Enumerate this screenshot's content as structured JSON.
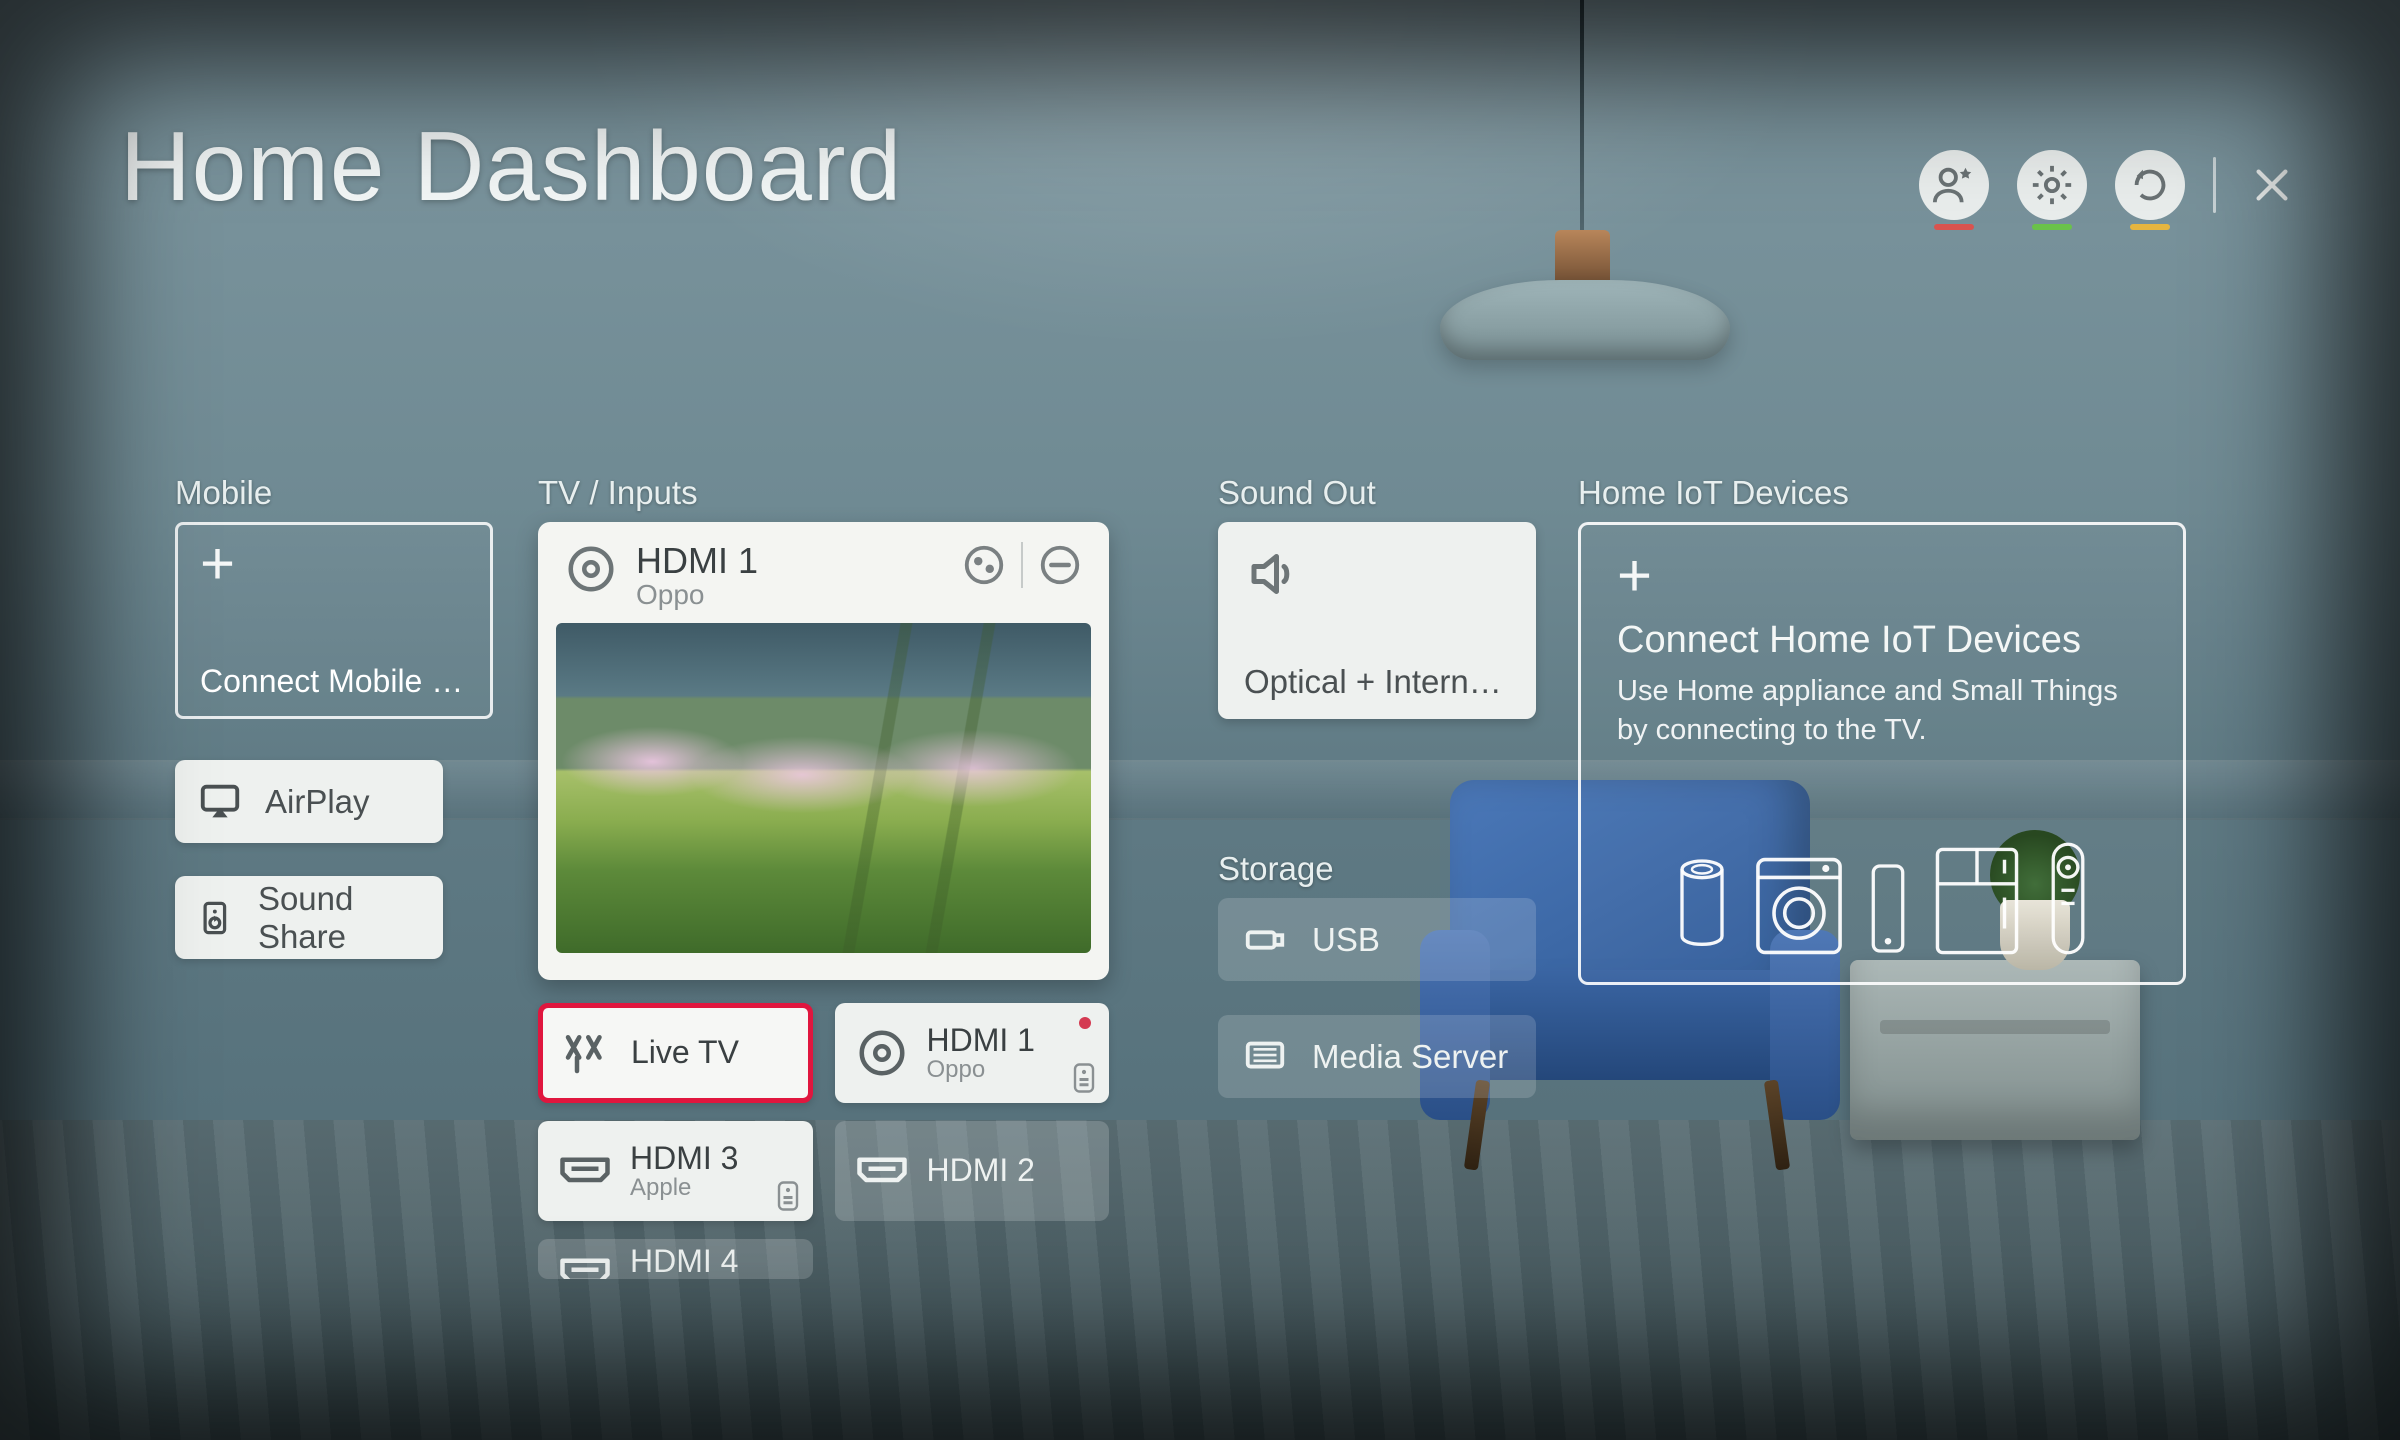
{
  "title": "Home Dashboard",
  "sections": {
    "mobile": "Mobile",
    "inputs": "TV / Inputs",
    "sound": "Sound Out",
    "storage": "Storage",
    "iot": "Home IoT Devices"
  },
  "mobile": {
    "connect_label": "Connect Mobile …",
    "airplay": "AirPlay",
    "sound_share": "Sound Share"
  },
  "inputs": {
    "hero": {
      "title": "HDMI 1",
      "subtitle": "Oppo"
    },
    "tiles": [
      {
        "title": "Live TV",
        "subtitle": "",
        "style": "focused",
        "icon": "antenna",
        "active": false,
        "remote": false
      },
      {
        "title": "HDMI 1",
        "subtitle": "Oppo",
        "style": "solid",
        "icon": "disc",
        "active": true,
        "remote": true
      },
      {
        "title": "HDMI 3",
        "subtitle": "Apple",
        "style": "solid",
        "icon": "hdmi",
        "active": false,
        "remote": true
      },
      {
        "title": "HDMI 2",
        "subtitle": "",
        "style": "ghost",
        "icon": "hdmi",
        "active": false,
        "remote": false
      },
      {
        "title": "HDMI 4",
        "subtitle": "",
        "style": "ghost peek",
        "icon": "hdmi",
        "active": false,
        "remote": false
      }
    ]
  },
  "sound": {
    "output_label": "Optical + Interna…"
  },
  "storage": {
    "usb": "USB",
    "media": "Media Server"
  },
  "iot": {
    "heading": "Connect Home IoT Devices",
    "description": "Use Home appliance and Small Things by connecting to the TV."
  },
  "top_actions": {
    "account_status": "red",
    "settings_status": "green",
    "refresh_status": "amber"
  }
}
